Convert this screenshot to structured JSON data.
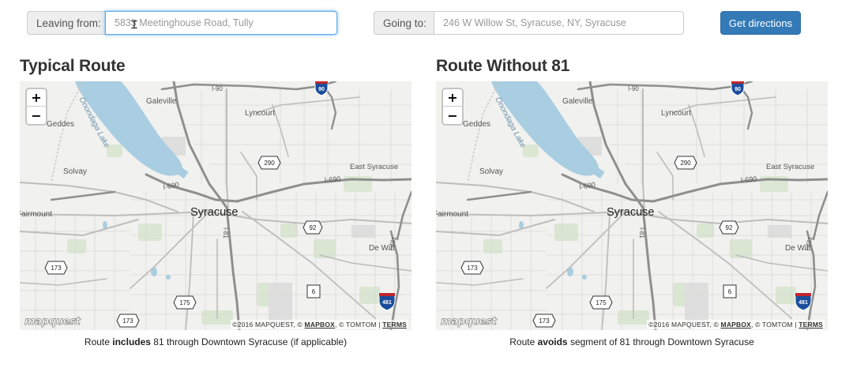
{
  "form": {
    "leaving_label": "Leaving from:",
    "leaving_placeholder": "5833 Meetinghouse Road, Tully",
    "going_label": "Going to:",
    "going_placeholder": "246 W Willow St, Syracuse, NY, Syracuse",
    "submit_label": "Get directions"
  },
  "panels": [
    {
      "title": "Typical Route",
      "caption_before": "Route ",
      "caption_bold": "includes",
      "caption_after": " 81 through Downtown Syracuse (if applicable)"
    },
    {
      "title": "Route Without 81",
      "caption_before": "Route ",
      "caption_bold": "avoids",
      "caption_after": " segment of 81 through Downtown Syracuse"
    }
  ],
  "map": {
    "zoom_in": "+",
    "zoom_out": "−",
    "logo": "mapquest",
    "attribution_prefix": "©2016 MAPQUEST, © ",
    "attribution_mapbox": "MAPBOX",
    "attribution_mid": ", © TOMTOM | ",
    "attribution_terms": "TERMS",
    "labels": {
      "city": "Syracuse",
      "lake": "Onondaga Lake",
      "galeville": "Galeville",
      "geddes": "Geddes",
      "lyncourt": "Lyncourt",
      "solvay": "Solvay",
      "east_syracuse": "East Syracuse",
      "fairmount": "Fairmount",
      "de_witt": "De Witt",
      "i690_a": "I-690",
      "i690_b": "I-690",
      "i90": "I-90",
      "i81": "I-81",
      "i481": "I-481",
      "i81_shield_top": "81",
      "shield_90": "90",
      "shield_290": "290",
      "shield_92": "92",
      "shield_173a": "173",
      "shield_173b": "173",
      "shield_175": "175",
      "shield_6": "6",
      "shield_481": "481"
    }
  },
  "colors": {
    "primary": "#337ab7",
    "focus": "#66afe9",
    "lake": "#a9cde1",
    "park": "#d5e3cc",
    "interstate_shield": "#1a4e9c"
  }
}
